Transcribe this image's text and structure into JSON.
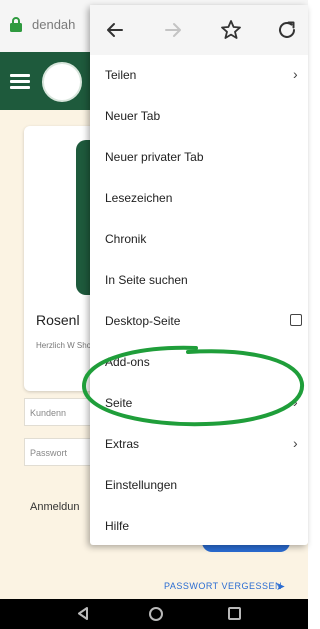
{
  "browser": {
    "url": "dendah"
  },
  "page": {
    "card": {
      "title": "Rosenl",
      "text": "Herzlich W Shop."
    },
    "customer_field_placeholder": "Kundenn",
    "password_field_placeholder": "Passwort",
    "login_label": "Anmeldun",
    "forgot_password": "PASSWORT VERGESSEN"
  },
  "menu": {
    "toolbar": [
      "back",
      "forward",
      "bookmark",
      "reload"
    ],
    "items": [
      {
        "label": "Teilen",
        "suffix": "arrow"
      },
      {
        "label": "Neuer Tab",
        "suffix": ""
      },
      {
        "label": "Neuer privater Tab",
        "suffix": ""
      },
      {
        "label": "Lesezeichen",
        "suffix": ""
      },
      {
        "label": "Chronik",
        "suffix": ""
      },
      {
        "label": "In Seite suchen",
        "suffix": ""
      },
      {
        "label": "Desktop-Seite",
        "suffix": "checkbox"
      },
      {
        "label": "Add-ons",
        "suffix": ""
      },
      {
        "label": "Seite",
        "suffix": "arrow"
      },
      {
        "label": "Extras",
        "suffix": "arrow"
      },
      {
        "label": "Einstellungen",
        "suffix": ""
      },
      {
        "label": "Hilfe",
        "suffix": ""
      }
    ]
  },
  "colors": {
    "site_header": "#1e5a3c",
    "page_background": "#fbf3e3",
    "accent_link": "#2a6cd2",
    "annotation": "#1f9e3a"
  }
}
